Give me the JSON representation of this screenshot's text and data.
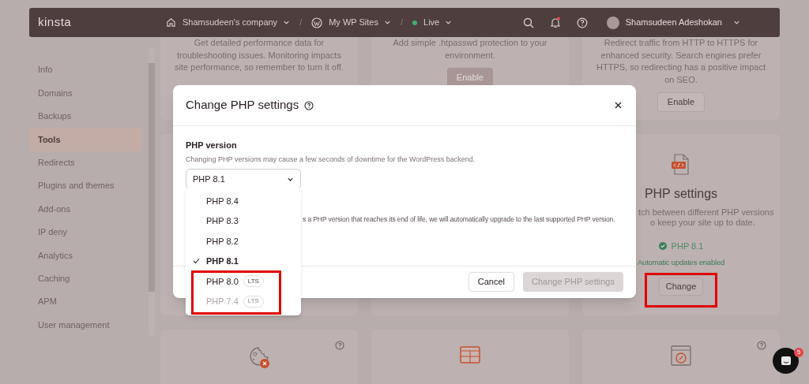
{
  "top_bar": {
    "logo": "kinsta",
    "breadcrumbs": [
      {
        "kind": "home",
        "label": "Shamsudeen's company"
      },
      {
        "kind": "wordpress",
        "label": "My WP Sites"
      },
      {
        "kind": "status",
        "label": "Live",
        "color": "#3fae6e"
      }
    ],
    "separator": "/",
    "notifications_unread": true,
    "user": "Shamsudeen Adeshokan"
  },
  "sidebar": {
    "items": [
      {
        "label": "Info",
        "selected": false
      },
      {
        "label": "Domains",
        "selected": false
      },
      {
        "label": "Backups",
        "selected": false
      },
      {
        "label": "Tools",
        "selected": true
      },
      {
        "label": "Redirects",
        "selected": false
      },
      {
        "label": "Plugins and themes",
        "selected": false
      },
      {
        "label": "Add-ons",
        "selected": false
      },
      {
        "label": "IP deny",
        "selected": false
      },
      {
        "label": "Analytics",
        "selected": false
      },
      {
        "label": "Caching",
        "selected": false
      },
      {
        "label": "APM",
        "selected": false
      },
      {
        "label": "User management",
        "selected": false
      }
    ]
  },
  "tool_cards": [
    {
      "description": [
        "Get detailed performance data for",
        "troubleshooting issues. Monitoring impacts",
        "site performance, so remember to turn it off."
      ]
    },
    {
      "description": [
        "Add simple .htpasswd protection to your",
        "environment."
      ],
      "button": {
        "label": "Enable",
        "disabled": true
      }
    },
    {
      "description": [
        "Redirect traffic from HTTP to HTTPS for",
        "enhanced security. Search engines prefer",
        "HTTPS, so redirecting has a positive impact",
        "on SEO."
      ],
      "button": {
        "label": "Enable",
        "disabled": false
      }
    }
  ],
  "php_card": {
    "title": "PHP settings",
    "description": [
      "tch between different PHP versions",
      "o keep your site up to date."
    ],
    "status": "PHP 8.1",
    "note": "Automatic updates enabled",
    "button": "Change"
  },
  "lower_cards": [
    {
      "kind": "cookie",
      "help": true
    },
    {
      "kind": "preview",
      "help": false
    },
    {
      "kind": "hints",
      "help": true
    }
  ],
  "dialog": {
    "title": "Change PHP settings",
    "field_label": "PHP version",
    "hint": "Changing PHP versions may cause a few seconds of downtime for the WordPress backend.",
    "select_value": "PHP 8.1",
    "partial_text": "s a PHP version that reaches its end of life, we will automatically upgrade to the last supported PHP version.",
    "cancel": "Cancel",
    "submit": {
      "label": "Change PHP settings",
      "disabled": true
    }
  },
  "dropdown": [
    {
      "label": "PHP 8.4",
      "selected": false,
      "disabled": false
    },
    {
      "label": "PHP 8.3",
      "selected": false,
      "disabled": false
    },
    {
      "label": "PHP 8.2",
      "selected": false,
      "disabled": false
    },
    {
      "label": "PHP 8.1",
      "selected": true,
      "disabled": false
    },
    {
      "label": "PHP 8.0",
      "selected": false,
      "disabled": false,
      "badge": "LTS"
    },
    {
      "label": "PHP 7.4",
      "selected": false,
      "disabled": true,
      "badge": "LTS"
    }
  ],
  "chat": {
    "badge": "5"
  }
}
